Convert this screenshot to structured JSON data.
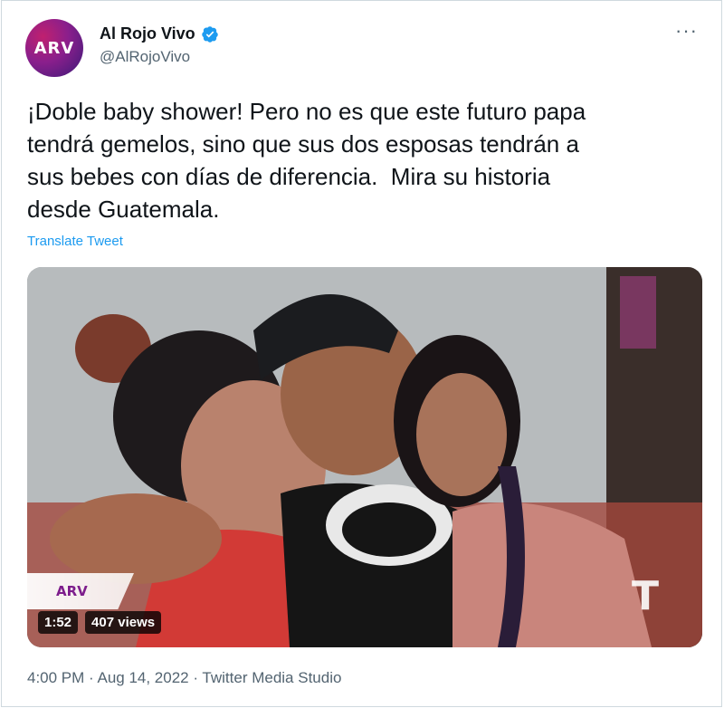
{
  "author": {
    "avatar_text": "ARV",
    "name": "Al Rojo Vivo",
    "handle": "@AlRojoVivo",
    "verified_icon": "verified-badge-icon"
  },
  "tweet": {
    "text": "¡Doble baby shower! Pero no es que este futuro papa\ntendrá gemelos, sino que sus dos esposas tendrán a\nsus bebes con días de diferencia.  Mira su historia\ndesde Guatemala.",
    "translate_label": "Translate Tweet"
  },
  "video": {
    "overlay_logo": "ARV",
    "network_logo": "T",
    "duration": "1:52",
    "views": "407 views"
  },
  "meta": {
    "timestamp": "4:00 PM · Aug 14, 2022 · Twitter Media Studio"
  },
  "colors": {
    "accent": "#1d9bf0",
    "muted": "#536471",
    "text": "#0f1419"
  }
}
